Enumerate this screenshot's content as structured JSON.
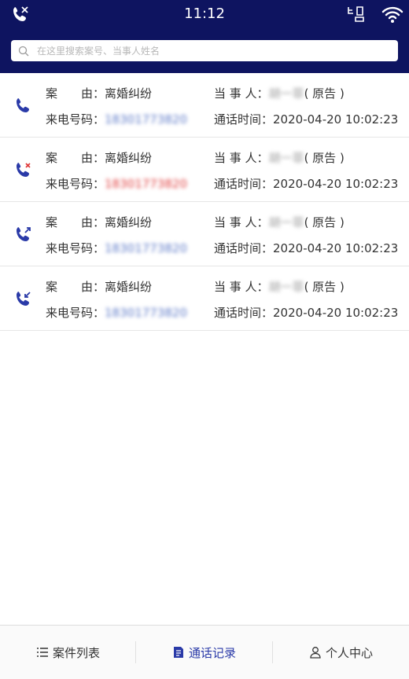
{
  "status": {
    "time": "11:12"
  },
  "search": {
    "placeholder": "在这里搜索案号、当事人姓名"
  },
  "labels": {
    "cause": "案　　由：",
    "caller": "来电号码：",
    "party": "当 事 人：",
    "call_time": "通话时间："
  },
  "records": [
    {
      "type": "incoming",
      "cause": "离婚纠纷",
      "phone": "18301773820",
      "party": "胡一菲",
      "role": "( 原告 )",
      "time": "2020-04-20  10:02:23",
      "phone_color": "#5b78c7"
    },
    {
      "type": "missed",
      "cause": "离婚纠纷",
      "phone": "18301773820",
      "party": "胡一菲",
      "role": "( 原告 )",
      "time": "2020-04-20  10:02:23",
      "phone_color": "#e03b3b"
    },
    {
      "type": "outgoing",
      "cause": "离婚纠纷",
      "phone": "18301773820",
      "party": "胡一菲",
      "role": "( 原告 )",
      "time": "2020-04-20  10:02:23",
      "phone_color": "#5b78c7"
    },
    {
      "type": "received",
      "cause": "离婚纠纷",
      "phone": "18301773820",
      "party": "胡一菲",
      "role": "( 原告 )",
      "time": "2020-04-20  10:02:23",
      "phone_color": "#5b78c7"
    }
  ],
  "tabs": [
    {
      "label": "案件列表",
      "icon": "list-icon",
      "active": false
    },
    {
      "label": "通话记录",
      "icon": "call-record-icon",
      "active": true
    },
    {
      "label": "个人中心",
      "icon": "user-icon",
      "active": false
    }
  ],
  "colors": {
    "header": "#0e1460",
    "accent": "#2a3aa8",
    "missed": "#e03b3b"
  }
}
